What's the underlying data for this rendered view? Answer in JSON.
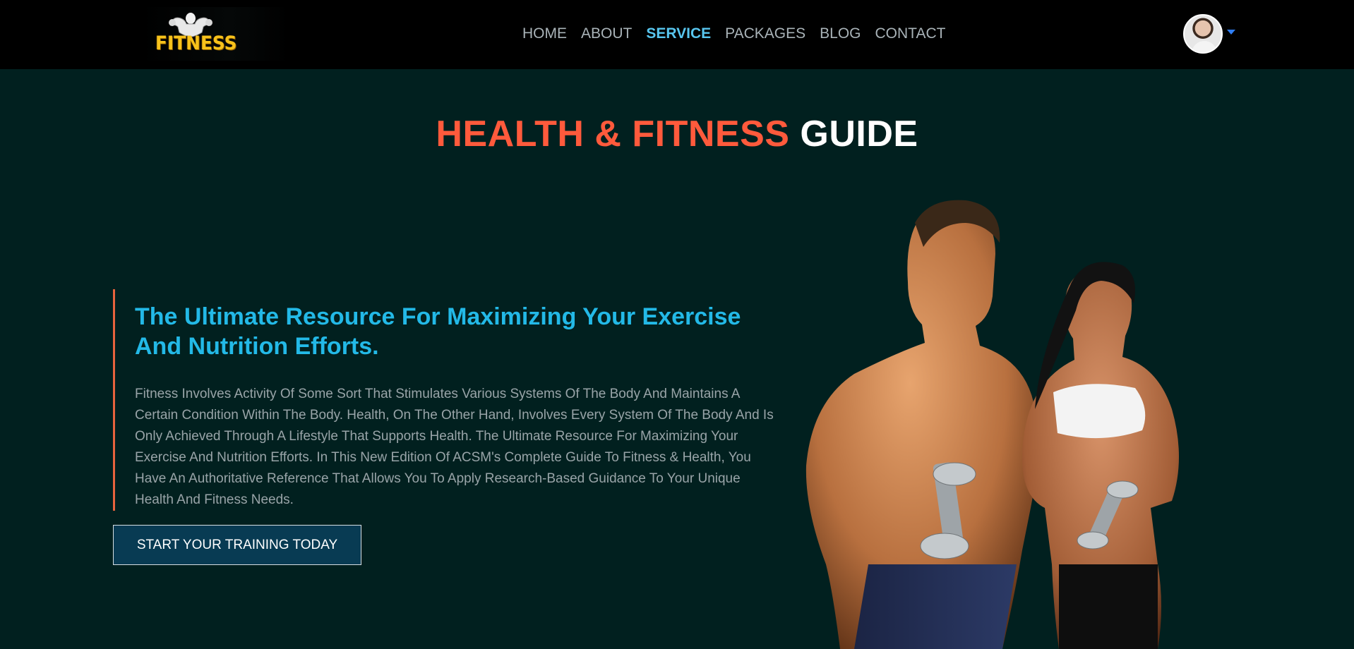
{
  "brand": {
    "logo_text": "FITNESS",
    "logo_color": "#f7c21b"
  },
  "nav": {
    "items": [
      {
        "label": "HOME"
      },
      {
        "label": "ABOUT"
      },
      {
        "label": "SERVICE",
        "active": true
      },
      {
        "label": "PACKAGES"
      },
      {
        "label": "BLOG"
      },
      {
        "label": "CONTACT"
      }
    ],
    "active_color": "#58c6ef"
  },
  "user_menu": {
    "avatar_icon": "user-avatar",
    "dropdown_icon": "caret-down-icon"
  },
  "hero": {
    "title_accent": "HEALTH & FITNESS",
    "title_plain": "GUIDE",
    "accent_color": "#ff5a3c",
    "subtitle": "The Ultimate Resource For Maximizing Your Exercise And Nutrition Efforts.",
    "body": "Fitness Involves Activity Of Some Sort That Stimulates Various Systems Of The Body And Maintains A Certain Condition Within The Body. Health, On The Other Hand, Involves Every System Of The Body And Is Only Achieved Through A Lifestyle That Supports Health. The Ultimate Resource For Maximizing Your Exercise And Nutrition Efforts. In This New Edition Of ACSM's Complete Guide To Fitness & Health, You Have An Authoritative Reference That Allows You To Apply Research-Based Guidance To Your Unique Health And Fitness Needs.",
    "cta_label": "START YOUR TRAINING TODAY"
  },
  "colors": {
    "background": "#01201f",
    "navbar": "#000000",
    "subtitle": "#23b9e7",
    "border_accent": "#e7633d",
    "button_bg": "#083b53"
  }
}
